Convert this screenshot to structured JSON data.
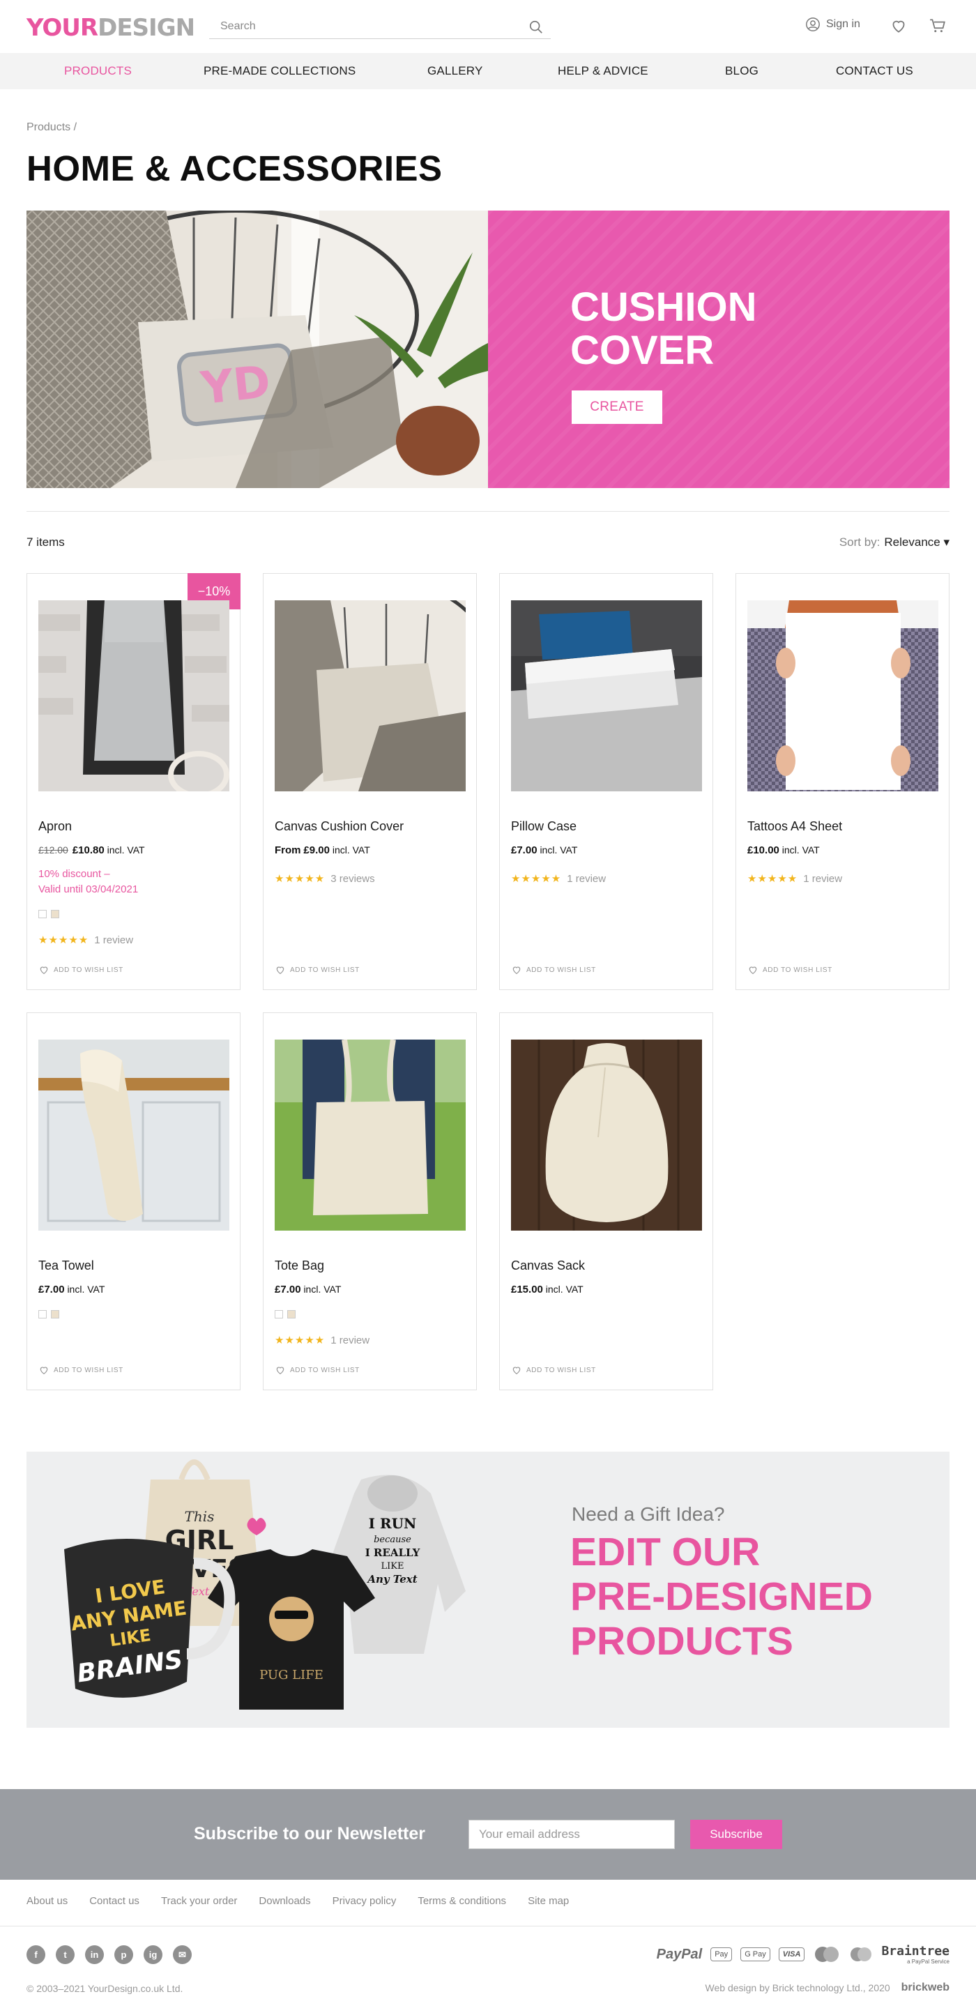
{
  "header": {
    "logo_part1": "YOUR",
    "logo_part2": "DESIGN",
    "search_placeholder": "Search",
    "signin_label": "Sign in"
  },
  "nav": {
    "items": [
      "PRODUCTS",
      "PRE-MADE COLLECTIONS",
      "GALLERY",
      "HELP & ADVICE",
      "BLOG",
      "CONTACT US"
    ],
    "active": "PRODUCTS"
  },
  "breadcrumb": "Products /",
  "page_title": "HOME & ACCESSORIES",
  "banner": {
    "logo_text": "YD",
    "title_line1": "CUSHION",
    "title_line2": "COVER",
    "button": "CREATE"
  },
  "listing": {
    "count": "7 items",
    "sort_label": "Sort by:",
    "sort_value": "Relevance ▾"
  },
  "products": [
    {
      "name": "Apron",
      "old_price": "£12.00",
      "price": "£10.80",
      "vat": "incl. VAT",
      "badge": "−10%",
      "discount_line1": "10% discount –",
      "discount_line2": "Valid until 03/04/2021",
      "stars": "★★★★★",
      "reviews": "1 review",
      "wish": "ADD TO WISH LIST"
    },
    {
      "name": "Canvas Cushion Cover",
      "price_prefix": "From",
      "price": "£9.00",
      "vat": "incl. VAT",
      "stars": "★★★★★",
      "reviews": "3 reviews",
      "wish": "ADD TO WISH LIST"
    },
    {
      "name": "Pillow Case",
      "price": "£7.00",
      "vat": "incl. VAT",
      "stars": "★★★★★",
      "reviews": "1 review",
      "wish": "ADD TO WISH LIST"
    },
    {
      "name": "Tattoos A4 Sheet",
      "price": "£10.00",
      "vat": "incl. VAT",
      "stars": "★★★★★",
      "reviews": "1 review",
      "wish": "ADD TO WISH LIST"
    },
    {
      "name": "Tea Towel",
      "price": "£7.00",
      "vat": "incl. VAT",
      "wish": "ADD TO WISH LIST"
    },
    {
      "name": "Tote Bag",
      "price": "£7.00",
      "vat": "incl. VAT",
      "stars": "★★★★★",
      "reviews": "1 review",
      "wish": "ADD TO WISH LIST"
    },
    {
      "name": "Canvas Sack",
      "price": "£15.00",
      "vat": "incl. VAT",
      "wish": "ADD TO WISH LIST"
    }
  ],
  "promo": {
    "subtitle": "Need a Gift Idea?",
    "title_line1": "EDIT OUR",
    "title_line2": "PRE-DESIGNED",
    "title_line3": "PRODUCTS",
    "mug_text1": "I LOVE",
    "mug_text2": "ANY NAME",
    "mug_text3": "LIKE",
    "mug_text4": "BRAINS",
    "bag_text1": "This",
    "bag_text2": "GIRL",
    "bag_text3": "LOVES",
    "bag_text4": "Any Text Here",
    "hoodie_text1": "I RUN",
    "hoodie_text2": "because",
    "hoodie_text3": "I REALLY",
    "hoodie_text4": "LIKE",
    "hoodie_text5": "Any Text",
    "tshirt_text": "PUG LIFE"
  },
  "newsletter": {
    "title": "Subscribe to our Newsletter",
    "placeholder": "Your email address",
    "button": "Subscribe"
  },
  "footer": {
    "links": [
      "About us",
      "Contact us",
      "Track your order",
      "Downloads",
      "Privacy policy",
      "Terms & conditions",
      "Site map"
    ],
    "social": [
      "f",
      "t",
      "in",
      "p",
      "ig",
      "✉"
    ],
    "payments": [
      "PayPal",
      "Pay",
      "G Pay",
      "VISA",
      "Braintree"
    ],
    "braintree_sub": "a PayPal Service",
    "copyright": "© 2003–2021 YourDesign.co.uk Ltd.",
    "credit": "Web design by Brick technology Ltd., 2020",
    "credit_brand": "brickweb"
  },
  "colors": {
    "accent": "#e8559f",
    "banner": "#e859ae",
    "newsletter_bg": "#9a9da2",
    "stars": "#f2b51d"
  }
}
